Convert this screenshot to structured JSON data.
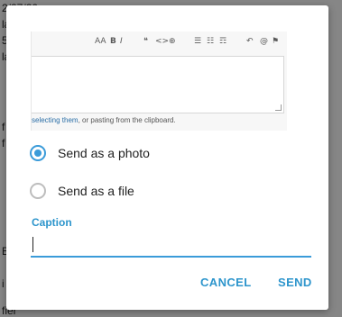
{
  "background": {
    "fragments": [
      "2/27/20",
      "la",
      "5",
      "la",
      "f",
      "f",
      "B",
      "i",
      "fier"
    ]
  },
  "preview": {
    "toolbar_items": [
      "AA",
      "B",
      "I",
      "❝",
      "<>",
      "⊕",
      "☰",
      "☷",
      "☶",
      "↶",
      "@",
      "⚑"
    ],
    "note_link": "selecting them",
    "note_text": ", or pasting from the clipboard."
  },
  "options": [
    {
      "label": "Send as a photo",
      "selected": true
    },
    {
      "label": "Send as a file",
      "selected": false
    }
  ],
  "caption": {
    "label": "Caption",
    "value": ""
  },
  "buttons": {
    "cancel": "CANCEL",
    "send": "SEND"
  },
  "colors": {
    "accent": "#2d95cc",
    "radio_checked": "#3a9bd9",
    "radio_unchecked": "#bdbdbd"
  }
}
